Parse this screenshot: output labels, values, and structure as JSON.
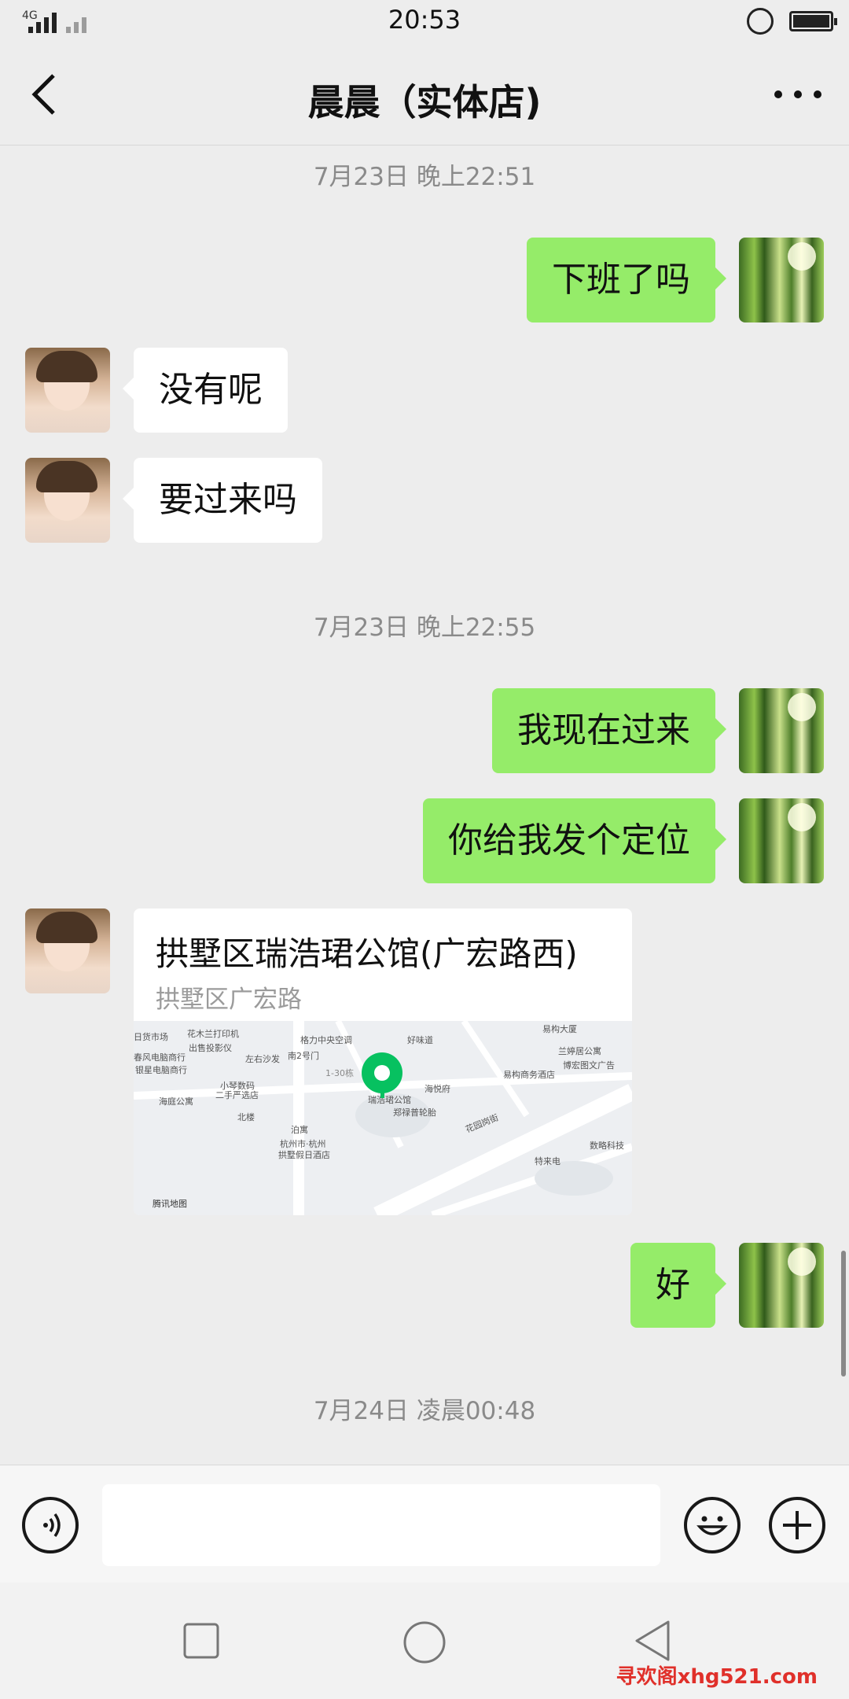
{
  "status_bar": {
    "time": "20:53",
    "network": "4G"
  },
  "header": {
    "title": "晨晨（实体店)"
  },
  "messages": {
    "ts1": "7月23日 晚上22:51",
    "m1": "下班了吗",
    "m2": "没有呢",
    "m3": "要过来吗",
    "ts2": "7月23日 晚上22:55",
    "m4": "我现在过来",
    "m5": "你给我发个定位",
    "location": {
      "title": "拱墅区瑞浩珺公馆(广宏路西)",
      "subtitle": "拱墅区广宏路",
      "map_labels": [
        "花木兰打印机",
        "格力中央空调",
        "好味道",
        "易构大厦",
        "日货市场",
        "出售投影仪",
        "南2号门",
        "兰婷居公寓",
        "春风电脑商行",
        "左右沙发",
        "博宏图文广告",
        "银星电脑商行",
        "1-30栋",
        "易构商务酒店",
        "小琴数码",
        "海悦府",
        "二手严选店",
        "海庭公寓",
        "瑞浩珺公馆",
        "郑禄普轮胎",
        "北楼",
        "花园岗街",
        "泊寓",
        "杭州市·杭州",
        "拱墅假日酒店",
        "数略科技",
        "特来电",
        "腾讯地图"
      ]
    },
    "m6": "好",
    "ts3": "7月24日 凌晨00:48"
  },
  "input": {
    "value": ""
  },
  "watermark": "寻欢阁xhg521.com",
  "colors": {
    "outgoing_bubble": "#95ec69",
    "incoming_bubble": "#ffffff",
    "background": "#ededed",
    "pin": "#07c160"
  },
  "icons": [
    "signal-icon",
    "screen-lock-icon",
    "battery-icon",
    "back-icon",
    "more-icon",
    "voice-icon",
    "emoji-icon",
    "add-icon",
    "nav-back-icon",
    "nav-home-icon",
    "nav-recents-icon",
    "map-pin-icon"
  ]
}
